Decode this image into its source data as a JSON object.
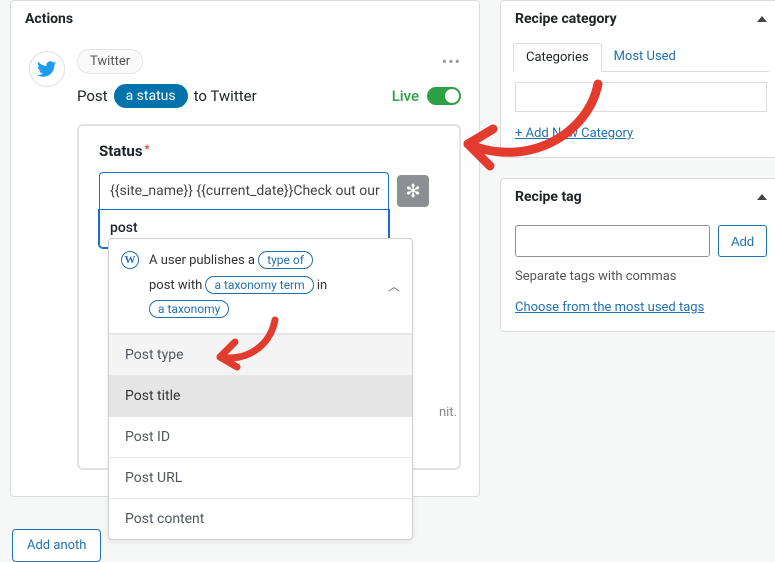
{
  "actions": {
    "title": "Actions",
    "service": "Twitter",
    "sentence_pre": "Post",
    "sentence_pill": "a status",
    "sentence_post": "to Twitter",
    "live_label": "Live",
    "status": {
      "label": "Status",
      "line1": "{{site_name}} {{current_date}}Check out our",
      "line2": "post",
      "limit_suffix": "nit."
    },
    "dropdown": {
      "header_pre": "A user publishes a",
      "token_type": "type of",
      "header_mid1": "post with",
      "token_tax_term": "a taxonomy term",
      "header_mid2": "in",
      "token_tax": "a taxonomy",
      "items": [
        "Post type",
        "Post title",
        "Post ID",
        "Post URL",
        "Post content"
      ]
    },
    "add_another": "Add anoth"
  },
  "category_panel": {
    "title": "Recipe category",
    "tab_categories": "Categories",
    "tab_most_used": "Most Used",
    "add_new": "+ Add New Category"
  },
  "tag_panel": {
    "title": "Recipe tag",
    "add_btn": "Add",
    "hint": "Separate tags with commas",
    "choose_link": "Choose from the most used tags"
  },
  "colors": {
    "red": "#e33b2e"
  }
}
